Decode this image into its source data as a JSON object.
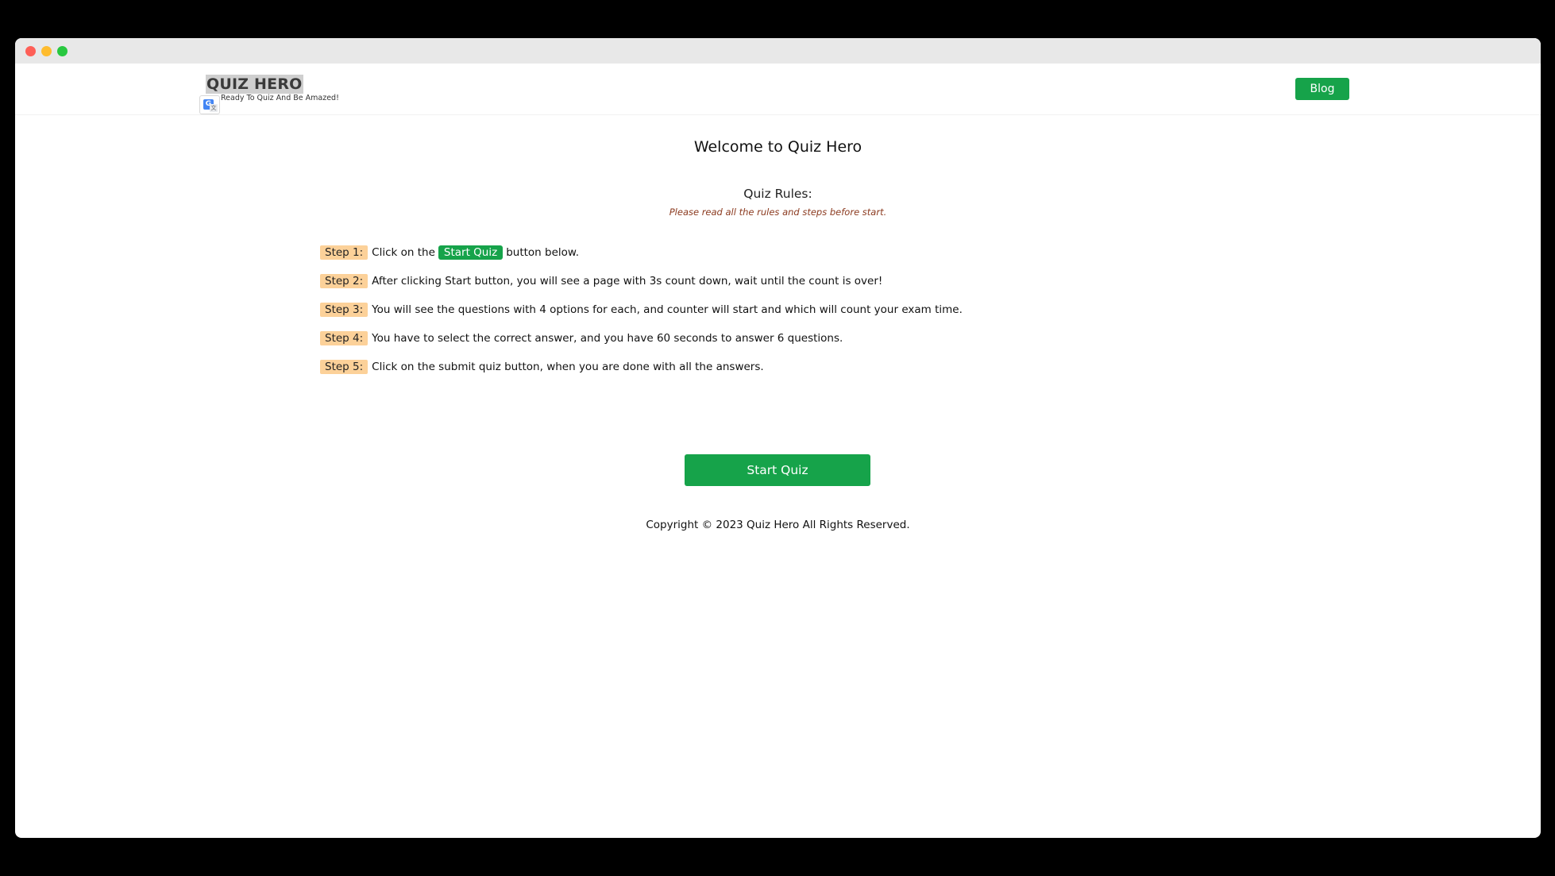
{
  "header": {
    "brand_title": "QUIZ HERO",
    "tagline": "Ready To Quiz And Be Amazed!",
    "blog_label": "Blog"
  },
  "main": {
    "welcome": "Welcome to Quiz Hero",
    "rules_title": "Quiz Rules:",
    "rules_note": "Please read all the rules and steps before start.",
    "steps": [
      {
        "badge": "Step 1:",
        "before": "Click on the",
        "inline_button": "Start Quiz",
        "after": "button below."
      },
      {
        "badge": "Step 2:",
        "text": "After clicking Start button, you will see a page with 3s count down, wait until the count is over!"
      },
      {
        "badge": "Step 3:",
        "text": "You will see the questions with 4 options for each, and counter will start and which will count your exam time."
      },
      {
        "badge": "Step 4:",
        "text": "You have to select the correct answer, and you have 60 seconds to answer 6 questions."
      },
      {
        "badge": "Step 5:",
        "text": "Click on the submit quiz button, when you are done with all the answers."
      }
    ],
    "start_button": "Start Quiz",
    "copyright": "Copyright © 2023 Quiz Hero All Rights Reserved."
  },
  "icons": {
    "translate": "google-translate-icon"
  },
  "colors": {
    "accent": "#16a34a",
    "step_badge": "#fcd199",
    "note": "#8b3a1f"
  }
}
